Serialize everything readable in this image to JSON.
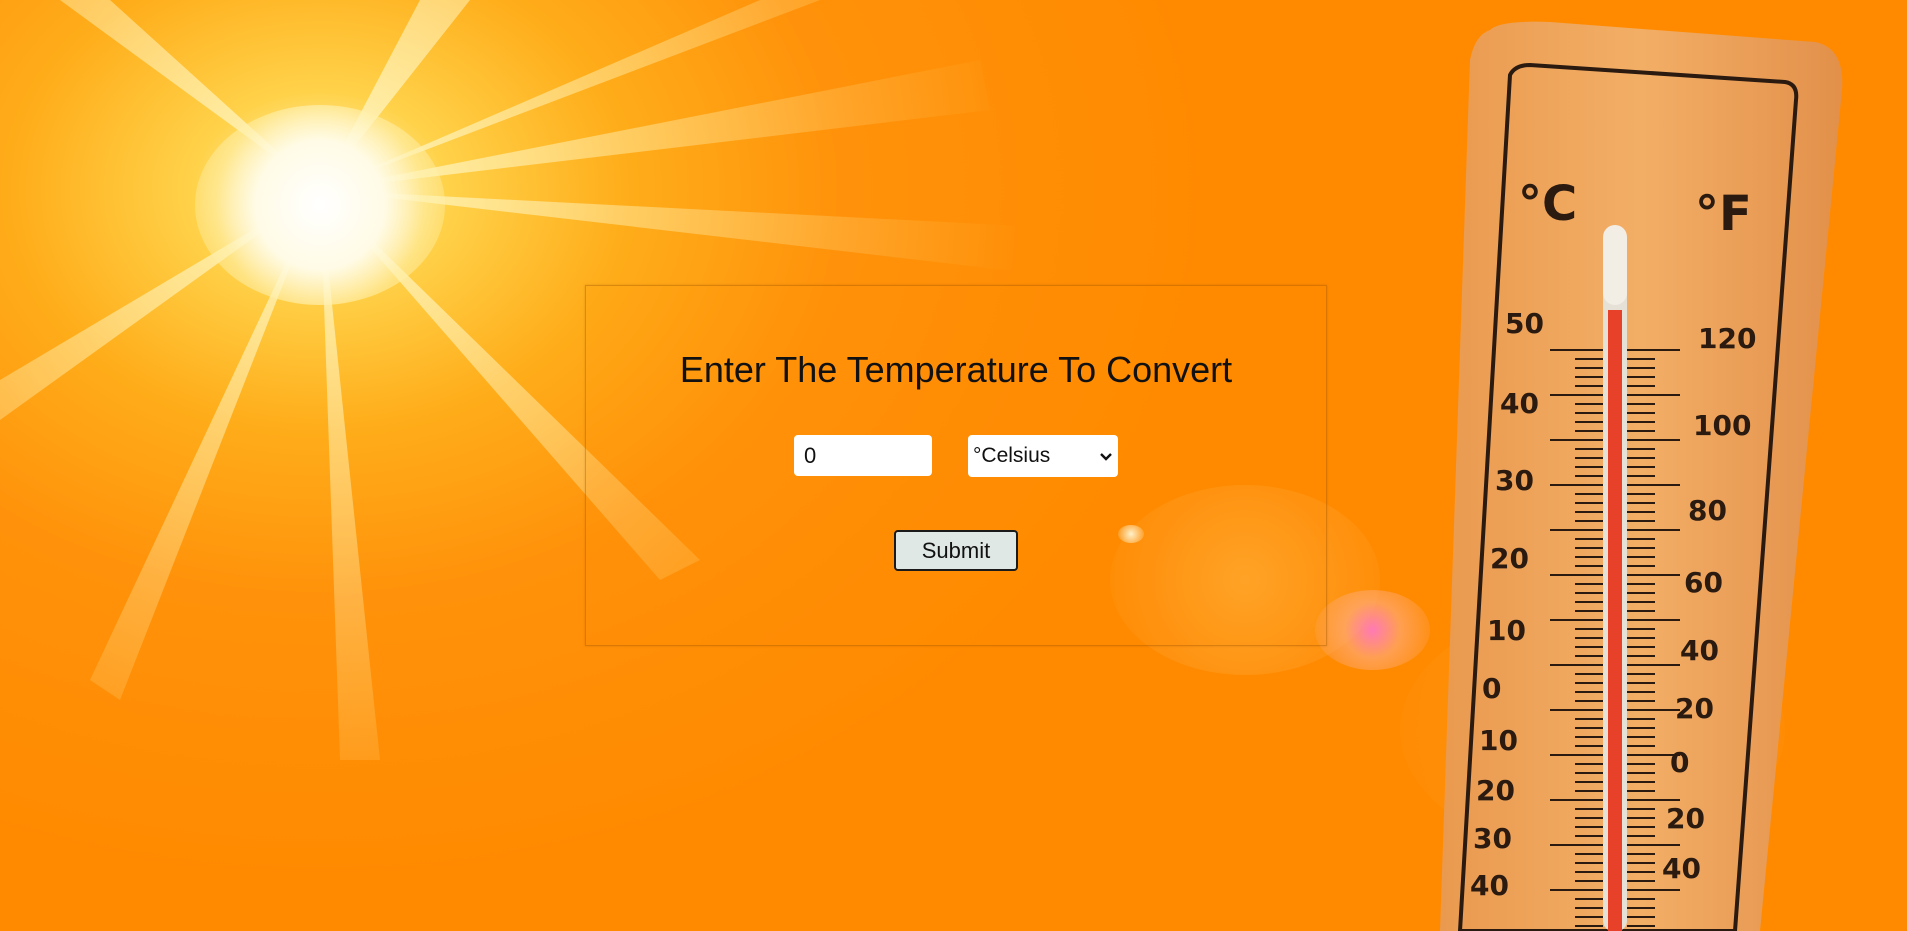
{
  "form": {
    "title": "Enter The Temperature To Convert",
    "temperature_value": "0",
    "unit_selected": "°Celsius",
    "submit_label": "Submit"
  },
  "thermometer": {
    "celsius_symbol": "°C",
    "fahrenheit_symbol": "°F",
    "celsius_scale": [
      "50",
      "40",
      "30",
      "20",
      "10",
      "0",
      "10",
      "20",
      "30",
      "40"
    ],
    "fahrenheit_scale": [
      "120",
      "100",
      "80",
      "60",
      "40",
      "20",
      "0",
      "20",
      "40"
    ]
  },
  "colors": {
    "background": "#ff8a00",
    "button_bg": "#dfe8e4",
    "mercury": "#e8412a"
  }
}
